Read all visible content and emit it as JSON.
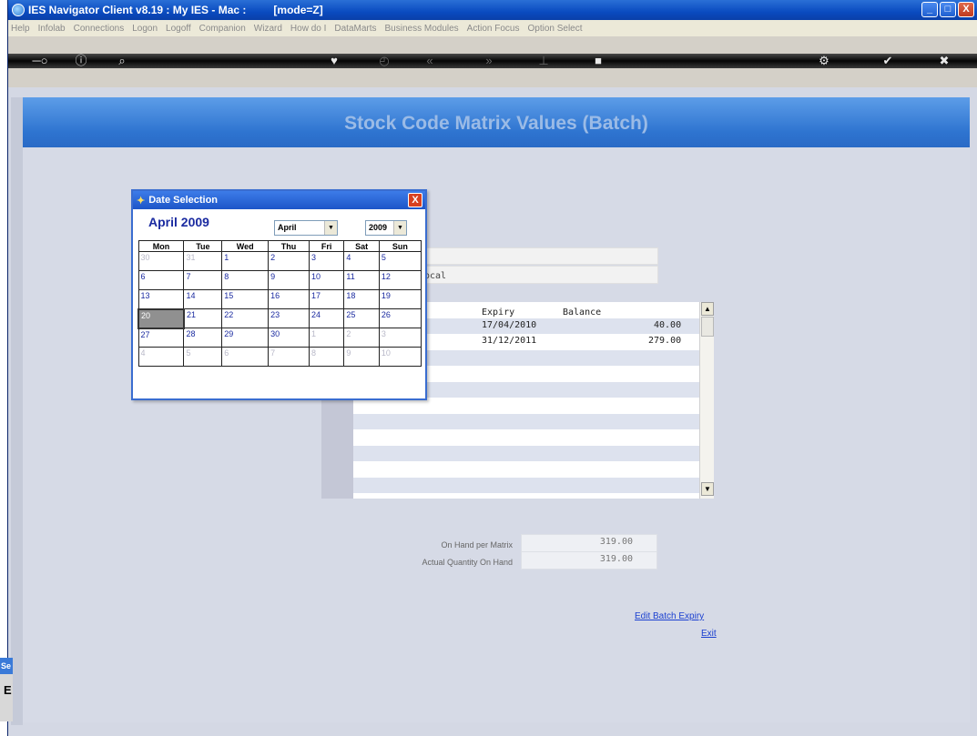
{
  "window": {
    "title": "IES Navigator Client v8.19 : My IES - Mac :",
    "mode": "[mode=Z]",
    "buttons": [
      "_",
      "□",
      "X"
    ]
  },
  "menu": [
    "Help",
    "Infolab",
    "Connections",
    "Logon",
    "Logoff",
    "Companion",
    "Wizard",
    "How do I",
    "DataMarts",
    "Business Modules",
    "Action Focus",
    "Option Select"
  ],
  "toolbar": {
    "icons": [
      "key-icon",
      "help-icon",
      "search-icon",
      "heart-icon",
      "clock-icon",
      "back-icon",
      "forward-icon",
      "tree-icon",
      "stop-icon",
      "settings-icon",
      "ok-icon",
      "close-icon"
    ]
  },
  "page": {
    "title": "Stock Code Matrix Values (Batch)"
  },
  "form": {
    "location_partial": "ocal"
  },
  "grid": {
    "columns": [
      "Expiry",
      "Balance"
    ],
    "rows": [
      {
        "expiry": "17/04/2010",
        "balance": "40.00"
      },
      {
        "expiry": "31/12/2011",
        "balance": "279.00"
      }
    ]
  },
  "summary": {
    "on_hand_matrix_label": "On Hand per Matrix",
    "on_hand_matrix_value": "319.00",
    "actual_qty_label": "Actual Quantity On Hand",
    "actual_qty_value": "319.00"
  },
  "links": {
    "edit_batch_expiry": "Edit Batch Expiry",
    "exit": "Exit"
  },
  "side_panel": {
    "tab_label": "Se",
    "text": "E"
  },
  "dialog": {
    "title": "Date Selection",
    "close": "X",
    "month_title": "April 2009",
    "month_select": "April",
    "year_select": "2009",
    "weekdays": [
      "Mon",
      "Tue",
      "Wed",
      "Thu",
      "Fri",
      "Sat",
      "Sun"
    ],
    "weeks": [
      [
        "30",
        "31",
        "1",
        "2",
        "3",
        "4",
        "5"
      ],
      [
        "6",
        "7",
        "8",
        "9",
        "10",
        "11",
        "12"
      ],
      [
        "13",
        "14",
        "15",
        "16",
        "17",
        "18",
        "19"
      ],
      [
        "20",
        "21",
        "22",
        "23",
        "24",
        "25",
        "26"
      ],
      [
        "27",
        "28",
        "29",
        "30",
        "1",
        "2",
        "3"
      ],
      [
        "4",
        "5",
        "6",
        "7",
        "8",
        "9",
        "10"
      ]
    ],
    "selected_day": "20"
  },
  "colors": {
    "title_bar": "#0a4bc0",
    "header_band": "#2e74d0",
    "link": "#1a3fd0",
    "calendar_text": "#1a2aa0"
  }
}
